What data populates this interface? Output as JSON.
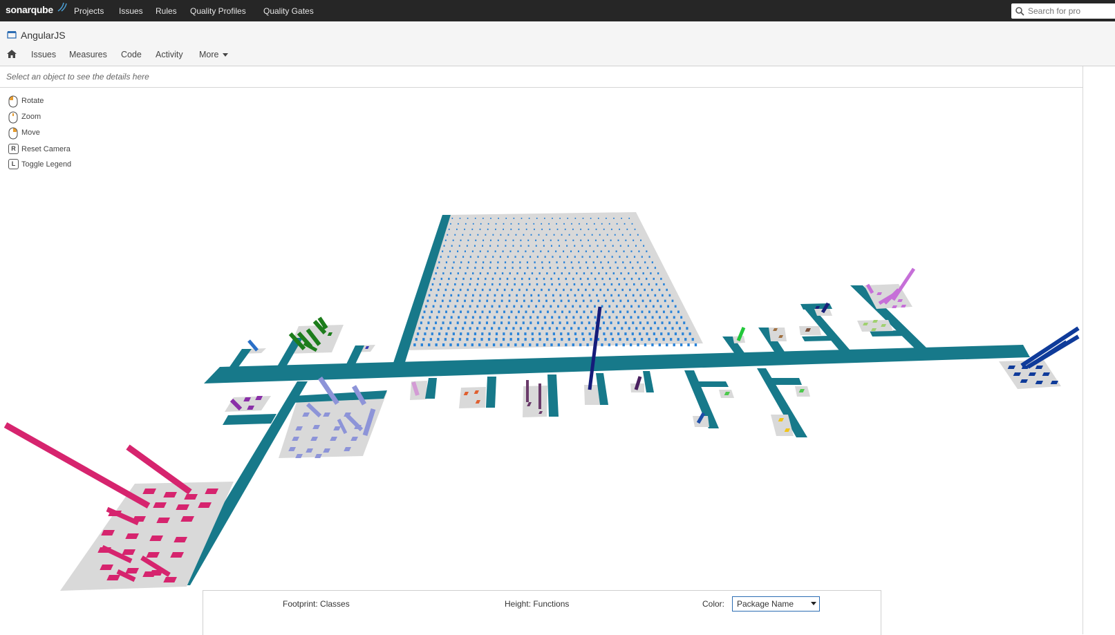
{
  "app": {
    "brand": "sonarqube",
    "nav": [
      "Projects",
      "Issues",
      "Rules",
      "Quality Profiles",
      "Quality Gates"
    ],
    "search_placeholder": "Search for pro"
  },
  "project": {
    "name": "AngularJS",
    "tabs": [
      "Issues",
      "Measures",
      "Code",
      "Activity",
      "More"
    ]
  },
  "details_hint": "Select an object to see the details here",
  "controls": [
    {
      "key": "mouse-left",
      "label": "Rotate"
    },
    {
      "key": "mouse-wheel",
      "label": "Zoom"
    },
    {
      "key": "mouse-right",
      "label": "Move"
    },
    {
      "key": "R",
      "label": "Reset Camera"
    },
    {
      "key": "L",
      "label": "Toggle Legend"
    }
  ],
  "legend": {
    "footprint": "Footprint: Classes",
    "height": "Height: Functions",
    "color_label": "Color:",
    "color_value": "Package Name"
  },
  "colors": {
    "topbar": "#262626",
    "street": "#17798a",
    "district": "#d9d9d9",
    "accent": "#2b6cb3"
  }
}
